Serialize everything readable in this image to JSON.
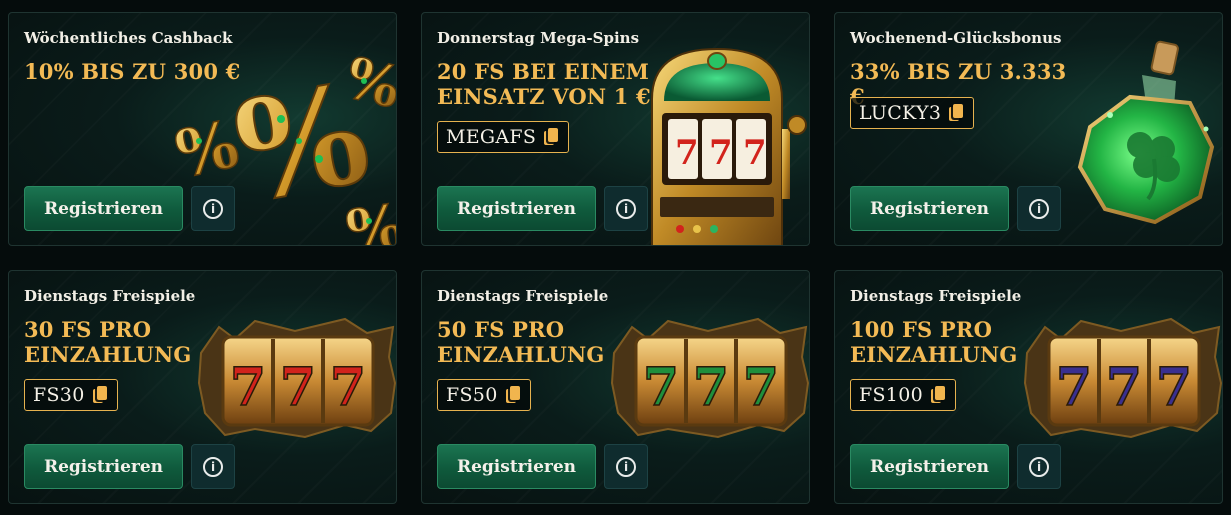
{
  "promotions": [
    {
      "title": "Wöchentliches Cashback",
      "offer": "10% BIS ZU 300 €",
      "code": "",
      "button": "Registrieren",
      "info": "i",
      "art": "percent-icons"
    },
    {
      "title": "Donnerstag Mega-Spins",
      "offer": "20 FS BEI EINEM EINSATZ VON 1 €",
      "code": "MEGAFS",
      "button": "Registrieren",
      "info": "i",
      "art": "slot-machine"
    },
    {
      "title": "Wochenend-Glücksbonus",
      "offer": "33% BIS ZU 3.333 €",
      "code": "LUCKY3",
      "button": "Registrieren",
      "info": "i",
      "art": "clover-potion"
    },
    {
      "title": "Dienstags Freispiele",
      "offer": "30 FS PRO EINZAHLUNG",
      "code": "FS30",
      "button": "Registrieren",
      "info": "i",
      "art": "slot-reels-red-sevens"
    },
    {
      "title": "Dienstags Freispiele",
      "offer": "50 FS PRO EINZAHLUNG",
      "code": "FS50",
      "button": "Registrieren",
      "info": "i",
      "art": "slot-reels-green-sevens"
    },
    {
      "title": "Dienstags Freispiele",
      "offer": "100 FS PRO EINZAHLUNG",
      "code": "FS100",
      "button": "Registrieren",
      "info": "i",
      "art": "slot-reels-blue-sevens"
    }
  ],
  "art": {
    "seven": "7",
    "percent": "%"
  },
  "colors": {
    "background": "#050c0c",
    "card": "#0a1c1a",
    "accent_gold": "#f3ba55",
    "button_green": "#1b7451",
    "info_bg": "#0f2c2e",
    "seven_red": "#d2231c",
    "seven_green": "#1f8f3c",
    "seven_blue": "#3a2f8f"
  }
}
